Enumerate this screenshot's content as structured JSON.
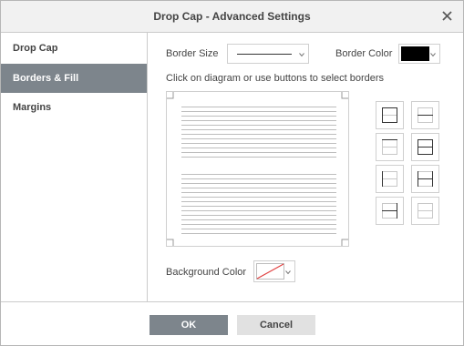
{
  "dialog": {
    "title": "Drop Cap - Advanced Settings"
  },
  "sidebar": {
    "items": [
      {
        "label": "Drop Cap",
        "active": false
      },
      {
        "label": "Borders & Fill",
        "active": true
      },
      {
        "label": "Margins",
        "active": false
      }
    ]
  },
  "borders": {
    "border_size_label": "Border Size",
    "border_color_label": "Border Color",
    "border_color_value": "#000000",
    "hint": "Click on diagram or use buttons to select borders",
    "buttons": [
      "outer-borders-icon",
      "horizontal-inner-border-icon",
      "top-border-icon",
      "all-borders-icon",
      "left-border-icon",
      "left-right-inner-borders-icon",
      "bottom-border-icon",
      "no-borders-icon"
    ]
  },
  "background": {
    "label": "Background Color",
    "value": "none"
  },
  "footer": {
    "ok_label": "OK",
    "cancel_label": "Cancel"
  },
  "colors": {
    "active_tab": "#7d858c",
    "ok_button": "#7d858c",
    "cancel_button": "#e1e1e1",
    "no_fill_slash": "#e04040"
  }
}
